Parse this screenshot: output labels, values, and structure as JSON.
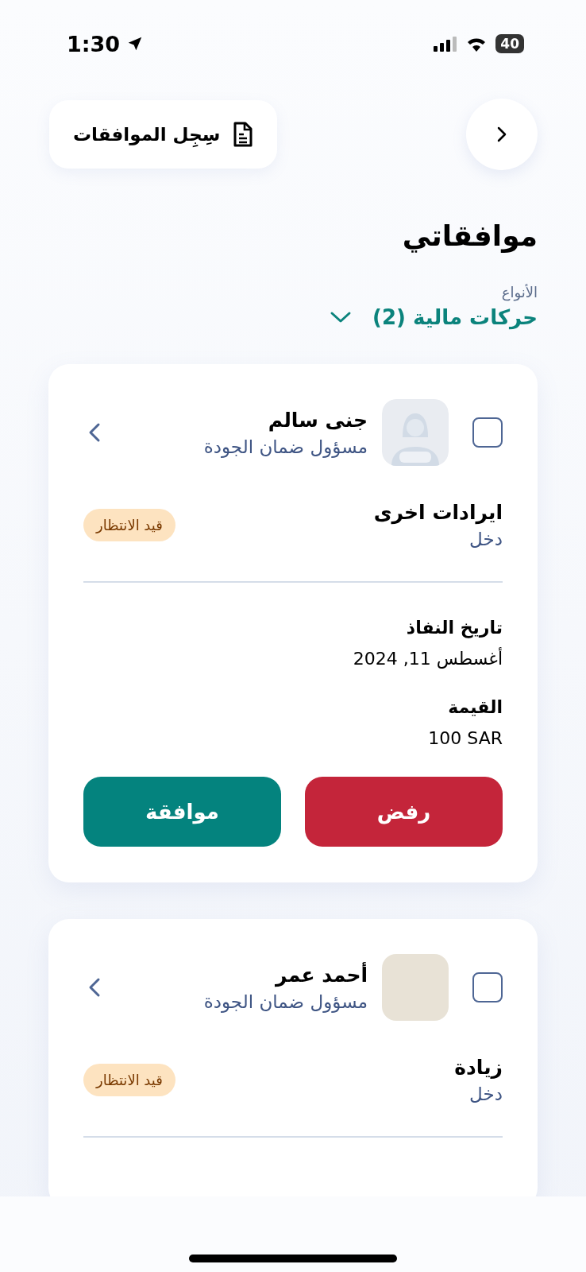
{
  "status_bar": {
    "time": "1:30",
    "battery": "40"
  },
  "header": {
    "history_button": {
      "label": "سِجِل الموافقات"
    }
  },
  "title": "موافقاتي",
  "filter": {
    "label": "الأنواع",
    "value": "حركات مالية (2)"
  },
  "cards": [
    {
      "checked": false,
      "kind": "placeholder",
      "name": "جنى سالم",
      "role": "مسؤول ضمان الجودة",
      "transaction": "ايرادات اخرى",
      "category": "دخل",
      "status": "قيد الانتظار",
      "fields": [
        {
          "label": "تاريخ النفاذ",
          "value": "أغسطس 11, 2024"
        },
        {
          "label": "القيمة",
          "value": "100 SAR"
        }
      ],
      "actions": [
        {
          "kind": "reject",
          "label": "رفض"
        },
        {
          "kind": "approve",
          "label": "موافقة"
        }
      ]
    },
    {
      "checked": false,
      "kind": "photo",
      "name": "أحمد عمر",
      "role": "مسؤول ضمان الجودة",
      "transaction": "زيادة",
      "category": "دخل",
      "status": "قيد الانتظار"
    }
  ]
}
